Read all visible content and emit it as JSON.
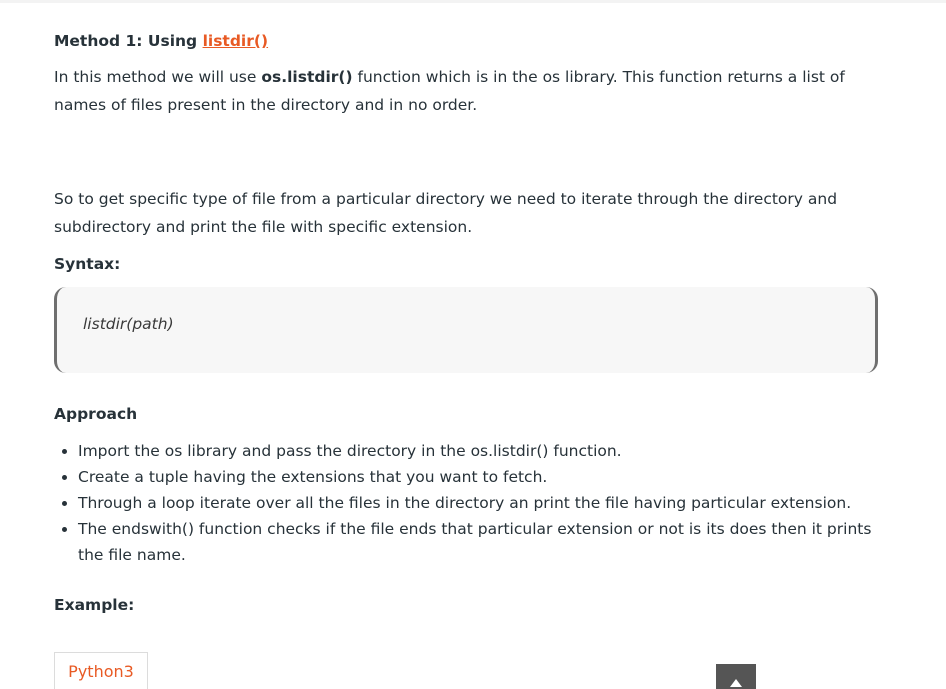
{
  "article": {
    "method_heading_prefix": "Method 1: Using ",
    "method_heading_link": "listdir()",
    "intro_part1": "In this method we will use ",
    "intro_bold": "os.listdir()",
    "intro_part2": " function which is in the os library. This function returns a list of names of files present in the directory and in no order.",
    "para2": "So to get specific type of file from a particular directory we need to iterate through the directory and subdirectory and print the file with specific extension.",
    "syntax_label": "Syntax:",
    "syntax_code": "listdir(path)",
    "approach_label": "Approach",
    "approach_steps": [
      "Import the os library and pass the directory in the os.listdir() function.",
      "Create a tuple having the extensions that you want to fetch.",
      "Through a loop iterate over all the files in the directory an print the file having particular extension.",
      "The endswith() function checks if the file ends that particular extension or not is its does then it prints the file name."
    ],
    "example_label": "Example:",
    "code_tab_label": "Python3"
  },
  "colors": {
    "link": "#e85a24",
    "text": "#273239",
    "code_bg": "#f7f7f7",
    "scroll_button": "#555555"
  },
  "icons": {
    "scroll_top": "arrow-up-icon"
  }
}
